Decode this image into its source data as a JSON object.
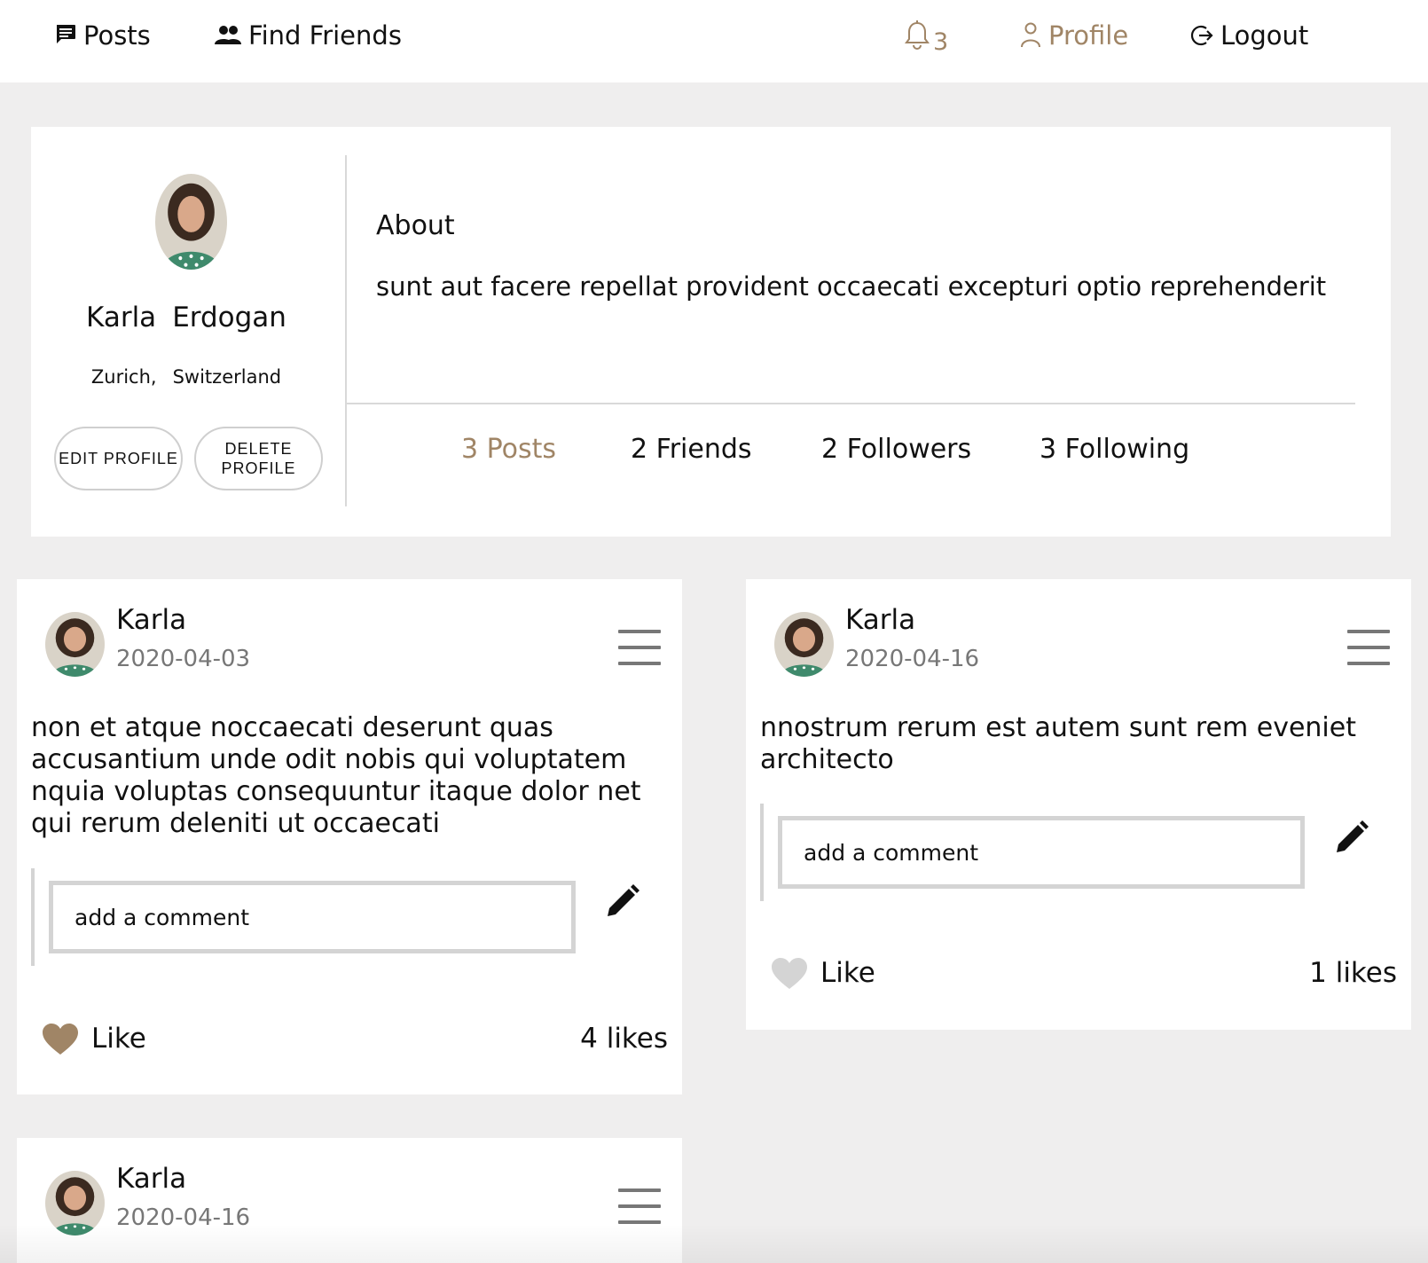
{
  "nav": {
    "posts_label": "Posts",
    "friends_label": "Find Friends",
    "notification_count": "3",
    "profile_label": "Profile",
    "logout_label": "Logout"
  },
  "profile": {
    "first_name": "Karla",
    "last_name": "Erdogan",
    "city": "Zurich,",
    "country": "Switzerland",
    "edit_button": "EDIT PROFILE",
    "delete_button": "DELETE PROFILE",
    "about_title": "About",
    "about_text": "sunt aut facere repellat provident occaecati excepturi optio reprehenderit",
    "stats": {
      "posts": "3 Posts",
      "friends": "2 Friends",
      "followers": "2 Followers",
      "following": "3 Following"
    }
  },
  "posts": [
    {
      "author": "Karla",
      "date": "2020-04-03",
      "body": "non et atque noccaecati deserunt quas accusantium unde odit nobis qui voluptatem nquia voluptas consequuntur itaque dolor net qui rerum deleniti ut occaecati",
      "comment_placeholder": "add a comment",
      "like_label": "Like",
      "likes": "4 likes",
      "liked": true
    },
    {
      "author": "Karla",
      "date": "2020-04-16",
      "body": "nnostrum rerum est autem sunt rem eveniet architecto",
      "comment_placeholder": "add a comment",
      "like_label": "Like",
      "likes": "1 likes",
      "liked": false
    },
    {
      "author": "Karla",
      "date": "2020-04-16"
    }
  ],
  "colors": {
    "accent": "#a08566",
    "heart_liked": "#a08566",
    "heart_unliked": "#d4d4d4",
    "page_bg": "#efeeee"
  },
  "icons": {
    "posts": "chat-bubble-icon",
    "friends": "people-icon",
    "notifications": "bell-icon",
    "profile": "person-icon",
    "logout": "logout-icon",
    "post_menu": "hamburger-menu-icon",
    "comment_submit": "pencil-icon",
    "like": "heart-icon"
  }
}
